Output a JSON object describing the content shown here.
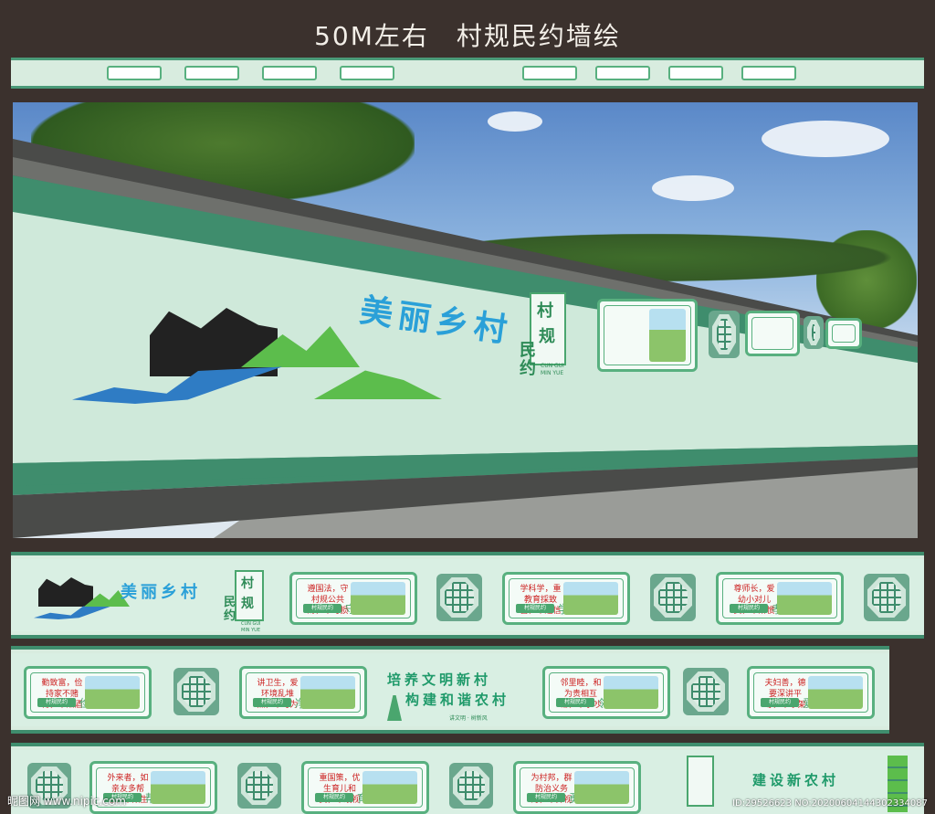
{
  "header": {
    "title": "50M左右　村规民约墙绘"
  },
  "scene": {
    "slogan": "美丽乡村",
    "logo": {
      "cun": "村",
      "gui": "规",
      "min": "民",
      "yue": "约",
      "pinyin1": "CUN GUI",
      "pinyin2": "MIN YUE"
    }
  },
  "strip1": {
    "slogan": "美丽乡村",
    "logo": {
      "cun": "村",
      "gui": "规",
      "min": "民",
      "yue": "约",
      "pinyin1": "CUN GUI",
      "pinyin2": "MIN YUE"
    },
    "panels": [
      {
        "text": "遵国法，守村规公共财，不可损",
        "char": "守"
      },
      {
        "text": "学科学，重教育採致富，不迷信",
        "char": "学"
      },
      {
        "text": "尊师长，爱幼小对儿女，不娇惯",
        "char": "孝"
      }
    ]
  },
  "strip2": {
    "panels": [
      {
        "text": "勤致富，俭持家不赌博，不酗酒",
        "char": "俭"
      },
      {
        "text": "讲卫生，爱环境乱堆点，不可为",
        "char": "净"
      },
      {
        "text": "邻里睦，和为贵相互帮，不争吵",
        "char": "邻"
      },
      {
        "text": "夫妇善，德要深讲平等，不吵架",
        "char": "爱"
      }
    ],
    "banner_line1": "培养文明新村",
    "banner_line2": "构建和谐农村",
    "banner_small": "讲文明 · 树新风"
  },
  "strip3": {
    "panels": [
      {
        "text": "外来者，如亲友多帮助，不欺生",
        "char": "帮"
      },
      {
        "text": "重国策，优生育儿和女，不歧视",
        "char": "育"
      },
      {
        "text": "为村邦，群防治义务为，不奔视",
        "char": "勇"
      }
    ],
    "banner": "建设新农村"
  },
  "panel_tag": "村规民约",
  "watermark": {
    "left": "昵图网 www.nipic.com",
    "right": "ID:29526623 NO:20200604144302334087"
  },
  "colors": {
    "green": "#3f8d6d",
    "light_green": "#d9efe3",
    "red_text": "#cc2222",
    "banner_green": "#1f9a6a"
  }
}
